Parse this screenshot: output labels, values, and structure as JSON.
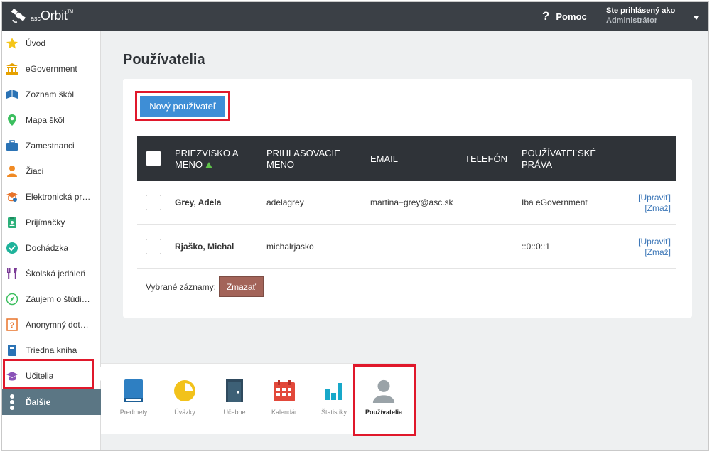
{
  "app": {
    "brand_small": "asc",
    "brand_big": "Orbit",
    "brand_tm": "TM"
  },
  "topbar": {
    "help_label": "Pomoc",
    "user_line1": "Ste prihlásený ako",
    "user_line2": "Administrátor"
  },
  "sidebar": {
    "items": [
      {
        "label": "Úvod",
        "icon": "star-icon"
      },
      {
        "label": "eGovernment",
        "icon": "government-building-icon"
      },
      {
        "label": "Zoznam škôl",
        "icon": "school-list-icon"
      },
      {
        "label": "Mapa škôl",
        "icon": "map-pin-icon"
      },
      {
        "label": "Zamestnanci",
        "icon": "briefcase-icon"
      },
      {
        "label": "Žiaci",
        "icon": "student-icon"
      },
      {
        "label": "Elektronická prihláška",
        "icon": "electronic-application-icon"
      },
      {
        "label": "Prijímačky",
        "icon": "admission-clipboard-icon"
      },
      {
        "label": "Dochádzka",
        "icon": "attendance-check-icon"
      },
      {
        "label": "Školská jedáleň",
        "icon": "canteen-icon"
      },
      {
        "label": "Záujem o štúdium",
        "icon": "compass-icon"
      },
      {
        "label": "Anonymný dotazník",
        "icon": "questionnaire-icon"
      },
      {
        "label": "Triedna kniha",
        "icon": "class-book-icon"
      },
      {
        "label": "Učitelia",
        "icon": "teacher-hat-icon"
      },
      {
        "label": "Ďalšie",
        "icon": "more-dots-icon"
      }
    ]
  },
  "main": {
    "title": "Používatelia",
    "new_user_button": "Nový používateľ",
    "columns": {
      "name": "PRIEZVISKO A MENO",
      "login": "PRIHLASOVACIE MENO",
      "email": "EMAIL",
      "phone": "TELEFÓN",
      "rights": "POUŽÍVATEĽSKÉ PRÁVA"
    },
    "rows": [
      {
        "name": "Grey, Adela",
        "login": "adelagrey",
        "email": "martina+grey@asc.sk",
        "phone": "",
        "rights": "Iba eGovernment",
        "edit": "[Upraviť]",
        "delete": "[Zmaž]"
      },
      {
        "name": "Rjaško, Michal",
        "login": "michalrjasko",
        "email": "",
        "phone": "",
        "rights": "::0::0::1",
        "edit": "[Upraviť]",
        "delete": "[Zmaž]"
      }
    ],
    "bulk_label": "Vybrané záznamy:",
    "bulk_delete": "Zmazať"
  },
  "more_panel": {
    "items": [
      {
        "label": "Predmety",
        "icon": "book-icon",
        "color": "#2e7fc2"
      },
      {
        "label": "Úväzky",
        "icon": "workload-pie-icon",
        "color": "#f2c21b"
      },
      {
        "label": "Učebne",
        "icon": "door-icon",
        "color": "#2f4a5e"
      },
      {
        "label": "Kalendár",
        "icon": "calendar-icon",
        "color": "#e2483a"
      },
      {
        "label": "Štatistiky",
        "icon": "bar-chart-icon",
        "color": "#18a8c9"
      },
      {
        "label": "Používatelia",
        "icon": "user-silhouette-icon",
        "color": "#9aa3a8"
      }
    ]
  },
  "colors": {
    "topbar": "#3b4046",
    "accent": "#3e8ed6",
    "active_sidebar": "#5b7684",
    "highlight": "#e0182b",
    "delete_button": "#a36459"
  }
}
